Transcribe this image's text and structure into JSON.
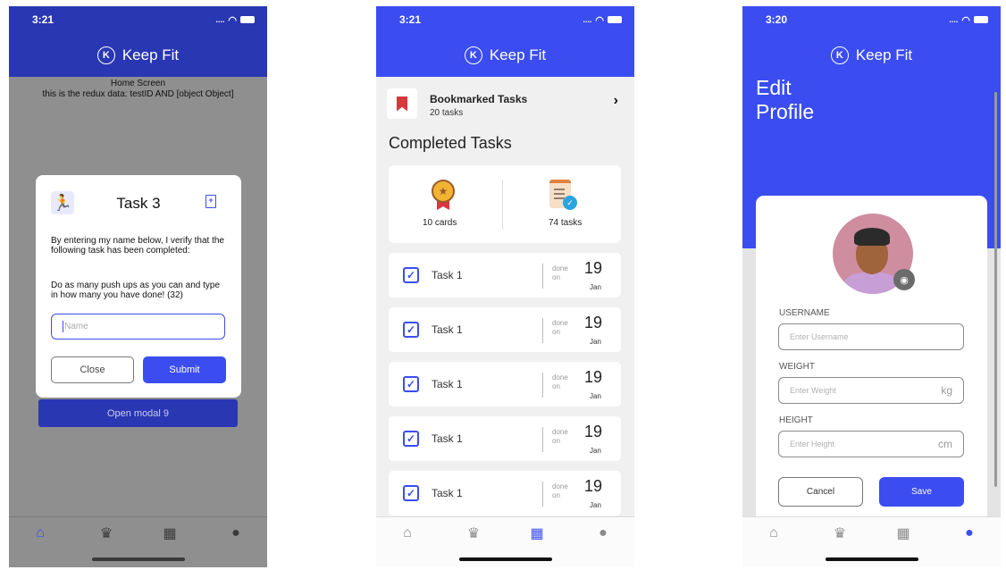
{
  "app": {
    "name": "Keep Fit",
    "logo_letter": "K"
  },
  "screens": {
    "home": {
      "status": {
        "time": "3:21",
        "signal": "....",
        "wifi": "wifi-icon"
      },
      "title": "Home Screen",
      "redux_text": "this is the redux data: testID AND [object Object]",
      "open_modal_label": "Open modal 9",
      "modal": {
        "title": "Task 3",
        "verify_text": "By entering my name below, I verify that the following task has been completed:",
        "instruction": "Do as many push ups as you can and type in how many you have done! (32)",
        "name_placeholder": "Name",
        "close_label": "Close",
        "submit_label": "Submit"
      },
      "active_tab": "home"
    },
    "calendar": {
      "status": {
        "time": "3:21",
        "signal": "...."
      },
      "bookmarked": {
        "title": "Bookmarked Tasks",
        "count": "20 tasks"
      },
      "completed_title": "Completed Tasks",
      "stats": {
        "cards": "10 cards",
        "tasks": "74 tasks"
      },
      "tasks": [
        {
          "name": "Task 1",
          "done": "done",
          "on": "on",
          "day": "19",
          "month": "Jan",
          "checked": true
        },
        {
          "name": "Task 1",
          "done": "done",
          "on": "on",
          "day": "19",
          "month": "Jan",
          "checked": true
        },
        {
          "name": "Task 1",
          "done": "done",
          "on": "on",
          "day": "19",
          "month": "Jan",
          "checked": true
        },
        {
          "name": "Task 1",
          "done": "done",
          "on": "on",
          "day": "19",
          "month": "Jan",
          "checked": true
        },
        {
          "name": "Task 1",
          "done": "done",
          "on": "on",
          "day": "19",
          "month": "Jan",
          "checked": true
        }
      ],
      "active_tab": "calendar"
    },
    "profile": {
      "status": {
        "time": "3:20",
        "signal": "...."
      },
      "title_line1": "Edit",
      "title_line2": "Profile",
      "username": {
        "label": "USERNAME",
        "placeholder": "Enter Username"
      },
      "weight": {
        "label": "WEIGHT",
        "placeholder": "Enter Weight",
        "unit": "kg"
      },
      "height": {
        "label": "HEIGHT",
        "placeholder": "Enter Height",
        "unit": "cm"
      },
      "cancel_label": "Cancel",
      "save_label": "Save",
      "active_tab": "profile"
    }
  },
  "tabs": [
    "home-icon",
    "trophy-icon",
    "calendar-icon",
    "person-icon"
  ],
  "colors": {
    "brand_blue": "#3b4df0",
    "dim_blue": "#2a37b3",
    "bookmark_red": "#d9363e"
  }
}
